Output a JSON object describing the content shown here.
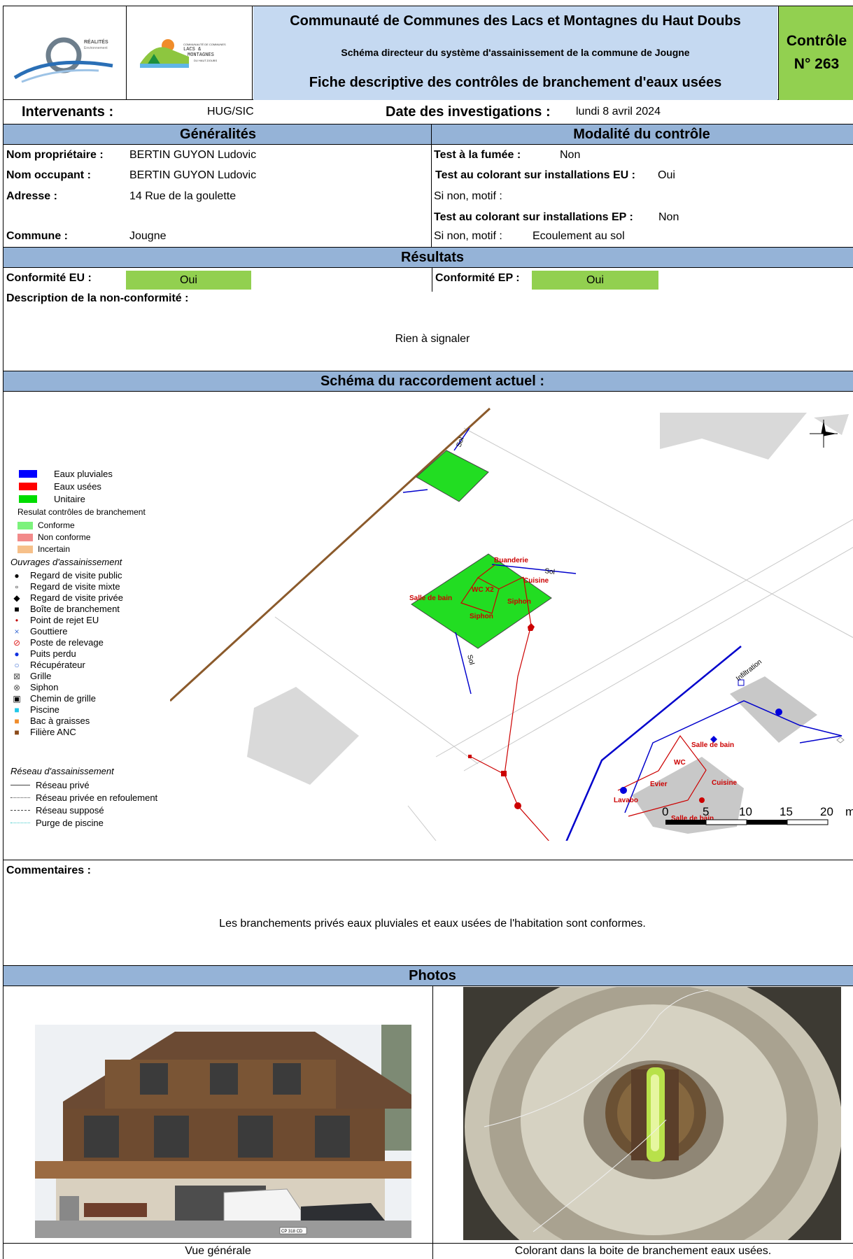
{
  "header": {
    "logo1_text": "RÉALITÉS",
    "logo1_sub": "Environnement",
    "logo2_line1": "COMMUNAUTÉ DE COMMUNES",
    "logo2_line2": "LACS &",
    "logo2_line3": "MONTAGNES",
    "logo2_line4": "DU HAUT-DOUBS",
    "title": "Communauté de Communes des Lacs et Montagnes du Haut Doubs",
    "subtitle": "Schéma directeur du système d'assainissement de la commune de Jougne",
    "doc_title": "Fiche descriptive des contrôles de branchement d'eaux usées",
    "controle_label": "Contrôle",
    "controle_num": "N° 263"
  },
  "info": {
    "intervenants_label": "Intervenants :",
    "intervenants_value": "HUG/SIC",
    "date_label": "Date des investigations :",
    "date_value": "lundi 8 avril 2024"
  },
  "generalites": {
    "title": "Généralités",
    "proprietaire_label": "Nom propriétaire :",
    "proprietaire_value": "BERTIN GUYON Ludovic",
    "occupant_label": "Nom occupant :",
    "occupant_value": "BERTIN GUYON Ludovic",
    "adresse_label": "Adresse :",
    "adresse_value": "14 Rue de la goulette",
    "commune_label": "Commune :",
    "commune_value": "Jougne"
  },
  "modalite": {
    "title": "Modalité du contrôle",
    "fumee_label": "Test à la fumée :",
    "fumee_value": "Non",
    "colorant_eu_label": "Test au colorant sur installations EU :",
    "colorant_eu_value": "Oui",
    "motif1_label": "Si non, motif :",
    "colorant_ep_label": "Test au colorant sur installations EP :",
    "colorant_ep_value": "Non",
    "motif2_label": "Si non, motif :",
    "motif2_value": "Ecoulement au sol"
  },
  "resultats": {
    "title": "Résultats",
    "conf_eu_label": "Conformité EU :",
    "conf_eu_value": "Oui",
    "conf_ep_label": "Conformité EP :",
    "conf_ep_value": "Oui",
    "desc_label": "Description de la non-conformité :",
    "desc_value": "Rien à signaler"
  },
  "schema": {
    "title": "Schéma du raccordement actuel :",
    "legend_colors": [
      {
        "label": "Eaux pluviales",
        "color": "#0000ff"
      },
      {
        "label": "Eaux usées",
        "color": "#ff0000"
      },
      {
        "label": "Unitaire",
        "color": "#00dd00"
      }
    ],
    "legend_result_title": "Resulat contrôles de branchement",
    "legend_results": [
      {
        "label": "Conforme",
        "color": "#7cf27c"
      },
      {
        "label": "Non conforme",
        "color": "#f28a8a"
      },
      {
        "label": "Incertain",
        "color": "#f6c08a"
      }
    ],
    "legend_ouvrages_title": "Ouvrages d'assainissement",
    "legend_ouvrages": [
      {
        "label": "Regard de visite public",
        "symbol": "●"
      },
      {
        "label": "Regard de visite mixte",
        "symbol": "▫"
      },
      {
        "label": "Regard de visite privée",
        "symbol": "◆"
      },
      {
        "label": "Boîte de branchement",
        "symbol": "■"
      },
      {
        "label": "Point de rejet EU",
        "symbol": "•"
      },
      {
        "label": "Gouttiere",
        "symbol": "×"
      },
      {
        "label": "Poste de relevage",
        "symbol": "⊘"
      },
      {
        "label": "Puits perdu",
        "symbol": "●"
      },
      {
        "label": "Récupérateur",
        "symbol": "○"
      },
      {
        "label": "Grille",
        "symbol": "⊠"
      },
      {
        "label": "Siphon",
        "symbol": "⊗"
      },
      {
        "label": "Chemin de grille",
        "symbol": "▣"
      },
      {
        "label": "Piscine",
        "symbol": "■"
      },
      {
        "label": "Bac à graisses",
        "symbol": "■"
      },
      {
        "label": "Filière ANC",
        "symbol": "■"
      }
    ],
    "legend_reseau_title": "Réseau d'assainissement",
    "legend_reseau": [
      {
        "label": "Réseau privé"
      },
      {
        "label": "Réseau privée en refoulement"
      },
      {
        "label": "Réseau supposé"
      },
      {
        "label": "Purge de piscine"
      }
    ],
    "map_labels": {
      "sol1": "Sol",
      "sol2": "Sol",
      "sol3": "Sol",
      "buanderie": "Buanderie",
      "cuisine1": "Cuisine",
      "wcx2": "WC X2",
      "salle_de_bain1": "Salle de bain",
      "siphon1": "Siphon",
      "siphon2": "Siphon",
      "infiltration": "Infiltration",
      "salle_de_bain2": "Salle de bain",
      "wc": "WC",
      "evier": "Evier",
      "cuisine2": "Cuisine",
      "lavabo": "Lavabo",
      "salle_de_bain3": "Salle de bain"
    },
    "scale": {
      "t0": "0",
      "t5": "5",
      "t10": "10",
      "t15": "15",
      "t20": "20",
      "unit": "m"
    }
  },
  "commentaires": {
    "label": "Commentaires :",
    "text": "Les branchements privés eaux pluviales et eaux usées de l'habitation sont conformes."
  },
  "photos": {
    "title": "Photos",
    "caption1": "Vue générale",
    "caption2": "Colorant dans la boite de branchement eaux usées.",
    "plate": "CP 318 CD"
  }
}
